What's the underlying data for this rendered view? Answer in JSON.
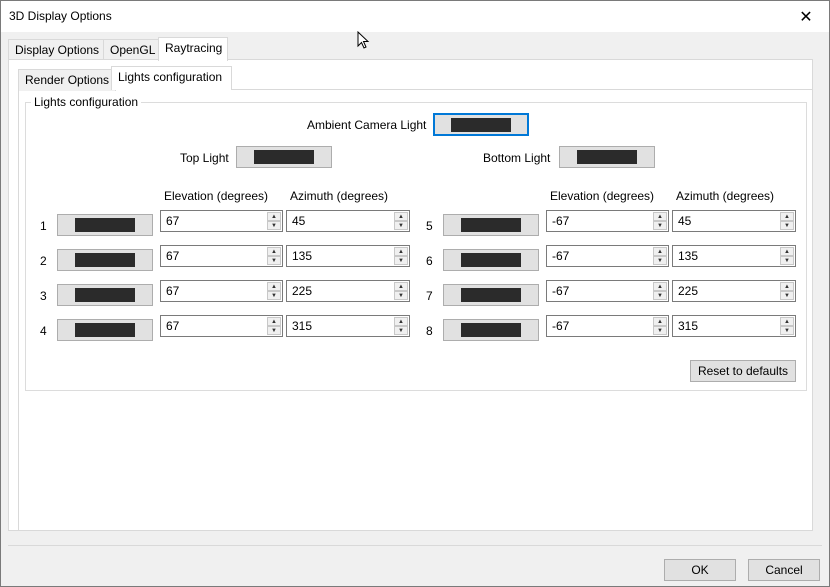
{
  "window": {
    "title": "3D Display Options",
    "close_symbol": "✕"
  },
  "main_tabs": [
    {
      "label": "Display Options",
      "active": false
    },
    {
      "label": "OpenGL",
      "active": false
    },
    {
      "label": "Raytracing",
      "active": true
    }
  ],
  "sub_tabs": [
    {
      "label": "Render Options",
      "active": false
    },
    {
      "label": "Lights configuration",
      "active": true
    }
  ],
  "group": {
    "title": "Lights configuration",
    "ambient_label": "Ambient Camera Light",
    "top_label": "Top Light",
    "bottom_label": "Bottom Light",
    "swatch_color": "#2b2b2b",
    "headers": {
      "elevation": "Elevation (degrees)",
      "azimuth": "Azimuth (degrees)"
    },
    "lights": [
      {
        "num": "1",
        "elevation": "67",
        "azimuth": "45"
      },
      {
        "num": "2",
        "elevation": "67",
        "azimuth": "135"
      },
      {
        "num": "3",
        "elevation": "67",
        "azimuth": "225"
      },
      {
        "num": "4",
        "elevation": "67",
        "azimuth": "315"
      },
      {
        "num": "5",
        "elevation": "-67",
        "azimuth": "45"
      },
      {
        "num": "6",
        "elevation": "-67",
        "azimuth": "135"
      },
      {
        "num": "7",
        "elevation": "-67",
        "azimuth": "225"
      },
      {
        "num": "8",
        "elevation": "-67",
        "azimuth": "315"
      }
    ],
    "reset_label": "Reset to defaults"
  },
  "footer": {
    "ok_label": "OK",
    "cancel_label": "Cancel"
  }
}
